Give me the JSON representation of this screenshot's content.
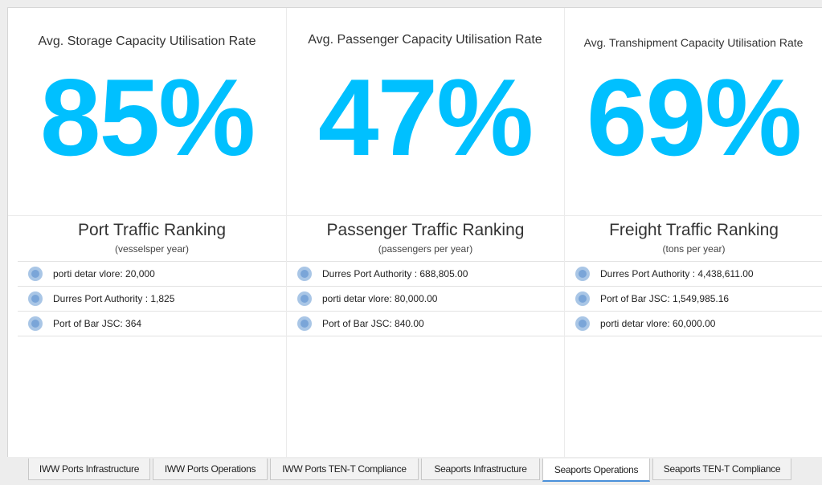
{
  "kpis": [
    {
      "title": "Avg. Storage Capacity Utilisation Rate",
      "value": "85%"
    },
    {
      "title": "Avg. Passenger Capacity Utilisation Rate",
      "value": "47%"
    },
    {
      "title": "Avg. Transhipment Capacity Utilisation Rate",
      "value": "69%"
    }
  ],
  "rankings": [
    {
      "title": "Port Traffic Ranking",
      "subtitle": "(vesselsper year)",
      "rows": [
        "porti detar vlore: 20,000",
        "Durres Port Authority : 1,825",
        "Port of Bar JSC: 364"
      ]
    },
    {
      "title": "Passenger Traffic Ranking",
      "subtitle": "(passengers per year)",
      "rows": [
        "Durres Port Authority : 688,805.00",
        "porti detar vlore: 80,000.00",
        "Port of Bar JSC: 840.00"
      ]
    },
    {
      "title": "Freight Traffic Ranking",
      "subtitle": "(tons per year)",
      "rows": [
        "Durres Port Authority : 4,438,611.00",
        "Port of Bar JSC: 1,549,985.16",
        "porti detar vlore: 60,000.00"
      ]
    }
  ],
  "tabs": [
    {
      "label": "IWW Ports Infrastructure",
      "active": false
    },
    {
      "label": "IWW Ports Operations",
      "active": false
    },
    {
      "label": "IWW Ports TEN-T Compliance",
      "active": false
    },
    {
      "label": "Seaports Infrastructure",
      "active": false
    },
    {
      "label": "Seaports Operations",
      "active": true
    },
    {
      "label": "Seaports TEN-T Compliance",
      "active": false
    }
  ],
  "colors": {
    "kpi_value": "#00c0ff",
    "active_tab_underline": "#4a90d9",
    "bullet": "#7aa5d8"
  }
}
